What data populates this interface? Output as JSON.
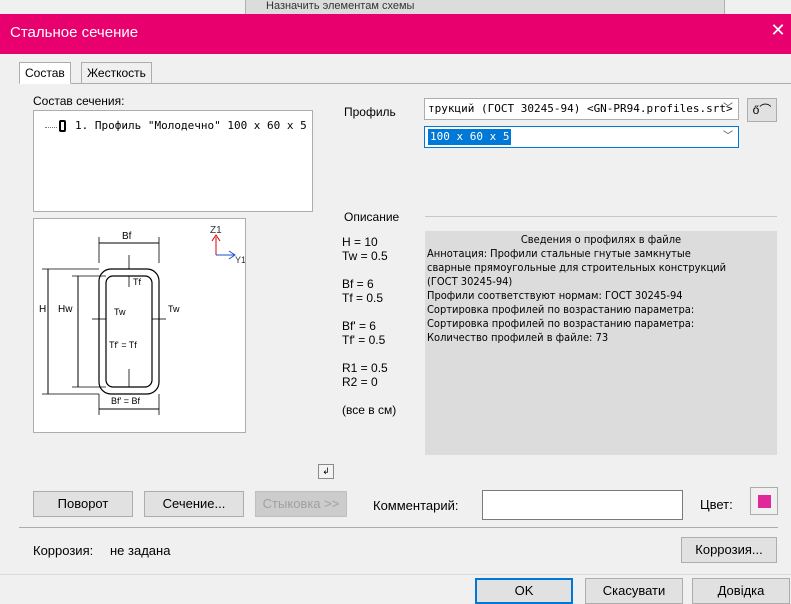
{
  "background": {
    "text": "Назначить элементам схемы"
  },
  "dialog": {
    "title": "Стальное сечение",
    "accent": "#e8006e"
  },
  "tabs": [
    {
      "label": "Состав",
      "active": true
    },
    {
      "label": "Жесткость",
      "active": false
    }
  ],
  "composition": {
    "label": "Состав сечения:",
    "items": [
      {
        "text": "1. Профиль \"Молодечно\" 100 x 60 x 5"
      }
    ]
  },
  "diagram": {
    "labels": {
      "bf_top": "Bf",
      "tf": "Tf",
      "tw_left": "Tw",
      "tw_right": "Tw",
      "h": "H",
      "hw": "Hw",
      "tf_eq": "Tf' = Tf",
      "bf_eq": "Bf' = Bf",
      "z1": "Z1",
      "y1": "Y1"
    }
  },
  "profile": {
    "label": "Профиль",
    "catalog_value": "трукций (ГОСТ 30245-94) <GN-PR94.profiles.srt>",
    "size_value": "100 x 60 x 5",
    "glasses_icon": "glasses-icon"
  },
  "description": {
    "label": "Описание",
    "params": [
      "H = 10",
      "Tw = 0.5",
      "",
      "Bf = 6",
      "Tf = 0.5",
      "",
      "Bf' = 6",
      "Tf' = 0.5",
      "",
      "R1 = 0.5",
      "R2 = 0",
      "",
      "(все в см)"
    ],
    "info_heading": "Сведения о профилях в файле",
    "info_lines": [
      "Аннотация: Профили стальные гнутые замкнутые",
      "сварные прямоугольные для строительных конструкций",
      "(ГОСТ 30245-94)",
      "Профили соответствуют нормам: ГОСТ 30245-94",
      "Сортировка профилей по возрастанию параметра:",
      "Сортировка профилей по возрастанию параметра:",
      "Количество профилей в файле: 73"
    ]
  },
  "small_button": {
    "icon": "return-arrow-icon",
    "glyph": "↲"
  },
  "actions": {
    "rotate": "Поворот",
    "section": "Сечение...",
    "docking": "Стыковка >>",
    "comment_label": "Комментарий:",
    "comment_value": "",
    "color_label": "Цвет:",
    "color_value": "#e0289a"
  },
  "corrosion": {
    "label": "Коррозия:",
    "value": "не задана",
    "button": "Коррозия..."
  },
  "footer": {
    "ok": "OK",
    "cancel": "Скасувати",
    "help": "Довідка"
  }
}
